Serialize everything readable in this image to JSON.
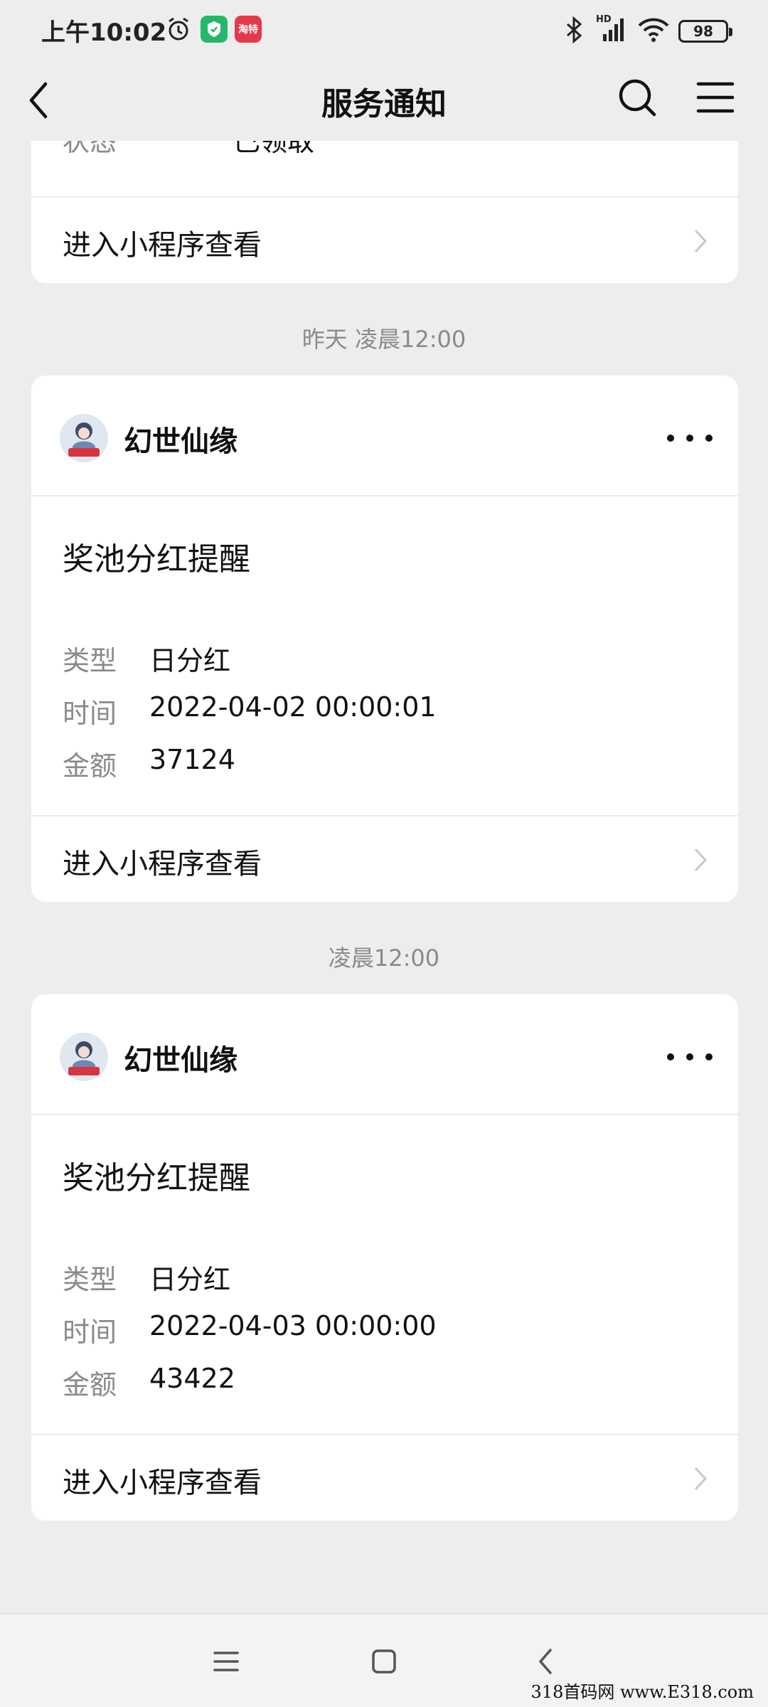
{
  "status_bar": {
    "time": "上午10:02",
    "battery": "98",
    "hd_label": "HD",
    "news_app_label": "淘特"
  },
  "header": {
    "title": "服务通知"
  },
  "partial_card": {
    "label": "状态",
    "value": "已领取",
    "footer": "进入小程序查看"
  },
  "messages": [
    {
      "timestamp": "昨天 凌晨12:00",
      "brand": "幻世仙缘",
      "title": "奖池分红提醒",
      "rows": [
        {
          "label": "类型",
          "value": "日分红"
        },
        {
          "label": "时间",
          "value": "2022-04-02 00:00:01"
        },
        {
          "label": "金额",
          "value": "37124"
        }
      ],
      "footer": "进入小程序查看"
    },
    {
      "timestamp": "凌晨12:00",
      "brand": "幻世仙缘",
      "title": "奖池分红提醒",
      "rows": [
        {
          "label": "类型",
          "value": "日分红"
        },
        {
          "label": "时间",
          "value": "2022-04-03 00:00:00"
        },
        {
          "label": "金额",
          "value": "43422"
        }
      ],
      "footer": "进入小程序查看"
    }
  ],
  "watermark": "318首码网 www.E318.com",
  "colors": {
    "background": "#ededed",
    "card": "#ffffff",
    "muted": "#8a8a8a",
    "shield": "#25b86a",
    "app_red": "#e5384b"
  }
}
